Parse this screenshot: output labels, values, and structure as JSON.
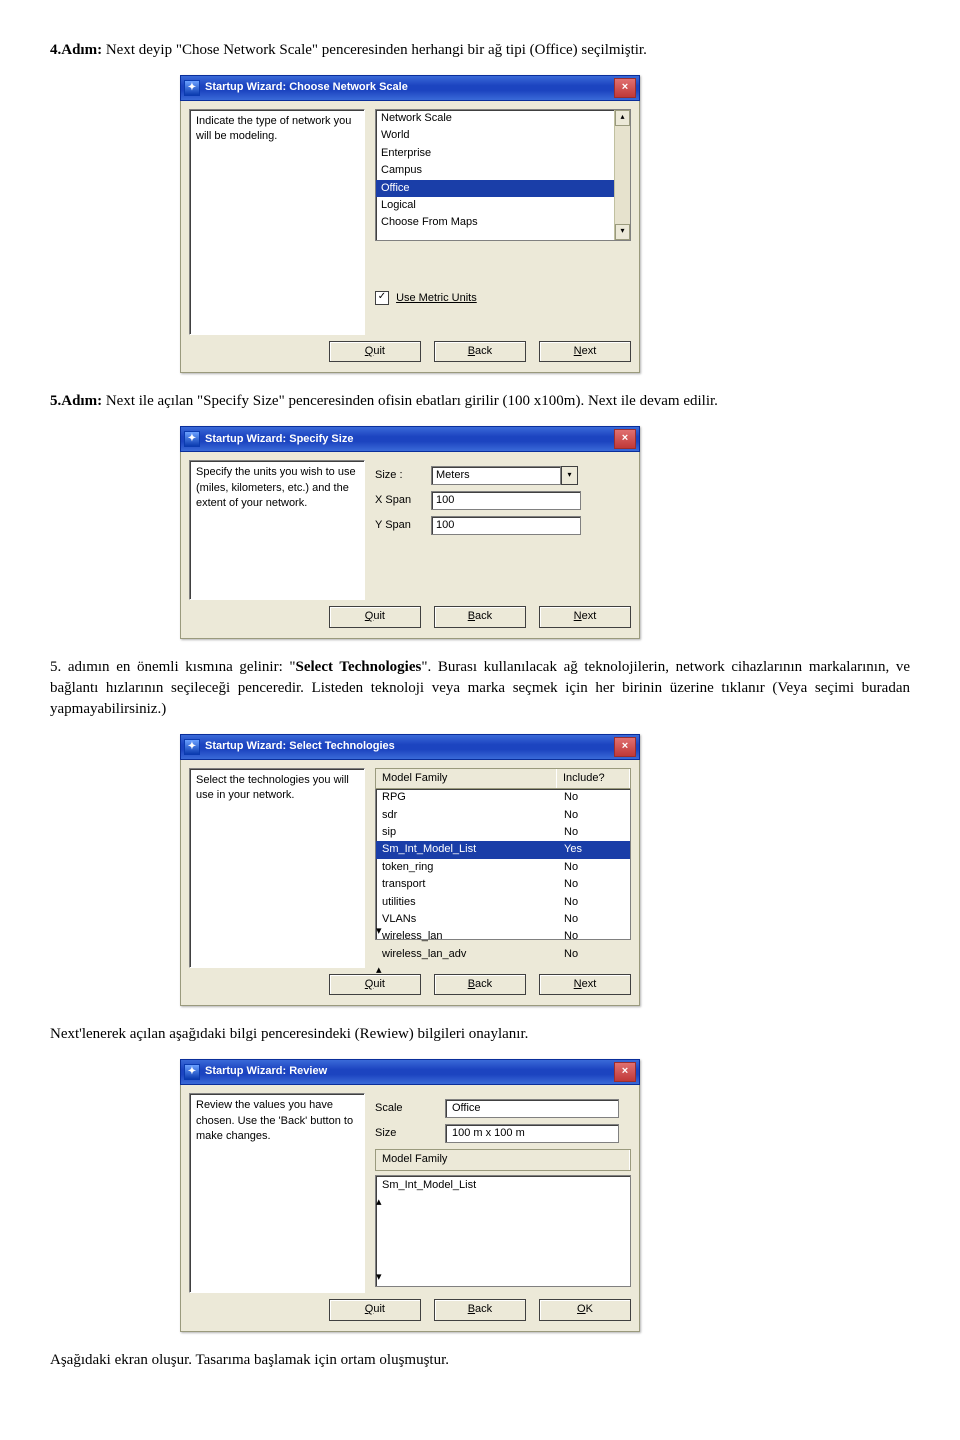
{
  "step4": {
    "heading": "4.Adım:",
    "text1": "  Next deyip \"Chose Network Scale\" penceresinden herhangi bir ağ tipi (Office) seçilmiştir.",
    "dialog": {
      "title": "Startup Wizard: Choose Network Scale",
      "instruction": "Indicate the type of network you will be modeling.",
      "items": [
        "Network Scale",
        "World",
        "Enterprise",
        "Campus",
        "Office",
        "Logical",
        "Choose From Maps"
      ],
      "selected": "Office",
      "checkbox": "Use Metric Units",
      "checked": true,
      "quit": "Quit",
      "back": "Back",
      "next": "Next",
      "quit_u": "Q",
      "back_u": "B",
      "next_u": "N"
    }
  },
  "step5": {
    "heading": "5.Adım:",
    "text1": "  Next  ile açılan \"Specify Size\" penceresinden ofisin ebatları girilir (100 x100m). Next ile devam edilir.",
    "dialog": {
      "title": "Startup Wizard: Specify Size",
      "instruction": "Specify the units you wish to use (miles, kilometers, etc.) and the extent of your network.",
      "size_lbl": "Size :",
      "size_val": "Meters",
      "xspan_lbl": "X Span",
      "xspan_val": "100",
      "yspan_lbl": "Y Span",
      "yspan_val": "100",
      "quit": "Quit",
      "back": "Back",
      "next": "Next"
    }
  },
  "para5b": {
    "text_a": "5.  adımın  en  önemli  kısmına  gelinir:  \"",
    "bold": "Select  Technologies",
    "text_b": "\".  Burası  kullanılacak  ağ  teknolojilerin, network cihazlarının markalarının, ve bağlantı hızlarının seçileceği penceredir. Listeden teknoloji veya marka seçmek için her birinin üzerine tıklanır (Veya seçimi buradan yapmayabilirsiniz.)"
  },
  "tech": {
    "title": "Startup Wizard: Select Technologies",
    "instruction": "Select the technologies you will use in your network.",
    "col1": "Model Family",
    "col2": "Include?",
    "rows": [
      {
        "n": "RPG",
        "v": "No"
      },
      {
        "n": "sdr",
        "v": "No"
      },
      {
        "n": "sip",
        "v": "No"
      },
      {
        "n": "Sm_Int_Model_List",
        "v": "Yes"
      },
      {
        "n": "token_ring",
        "v": "No"
      },
      {
        "n": "transport",
        "v": "No"
      },
      {
        "n": "utilities",
        "v": "No"
      },
      {
        "n": "VLANs",
        "v": "No"
      },
      {
        "n": "wireless_lan",
        "v": "No"
      },
      {
        "n": "wireless_lan_adv",
        "v": "No"
      }
    ],
    "sel": "Sm_Int_Model_List",
    "quit": "Quit",
    "back": "Back",
    "next": "Next"
  },
  "para_next": "Next'lenerek  açılan aşağıdaki bilgi penceresindeki (Rewiew) bilgileri onaylanır.",
  "review": {
    "title": "Startup Wizard: Review",
    "instruction": "Review the values you have chosen. Use the 'Back' button to make changes.",
    "scale_lbl": "Scale",
    "scale_val": "Office",
    "size_lbl": "Size",
    "size_val": "100 m x 100 m",
    "col": "Model Family",
    "item": "Sm_Int_Model_List",
    "quit": "Quit",
    "back": "Back",
    "ok": "OK"
  },
  "para_last": "Aşağıdaki ekran oluşur. Tasarıma başlamak için ortam oluşmuştur."
}
